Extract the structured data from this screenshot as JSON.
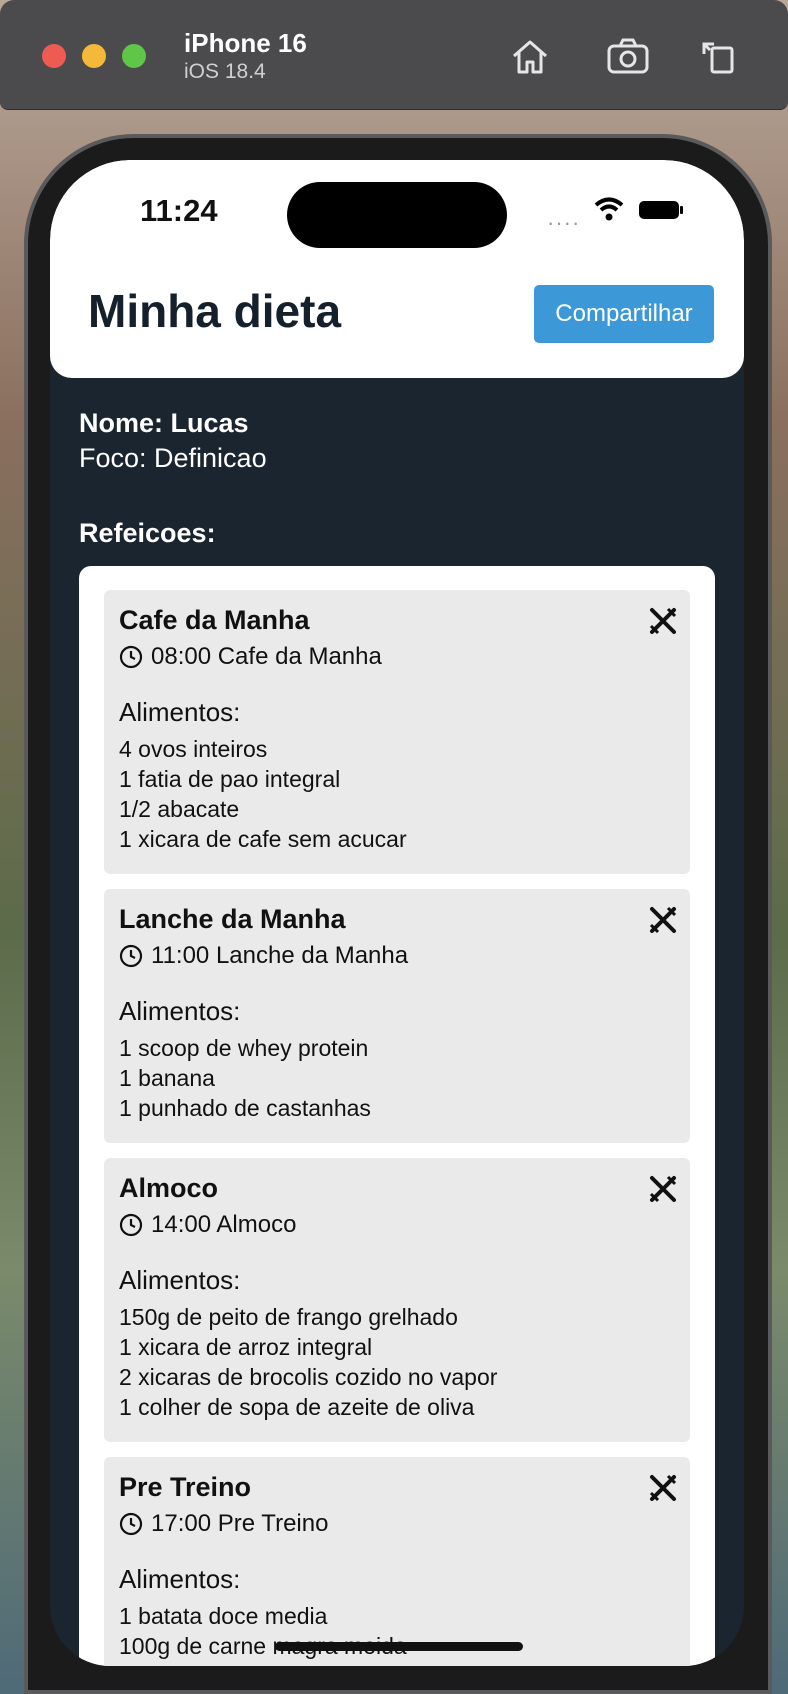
{
  "simulator": {
    "device": "iPhone 16",
    "os": "iOS 18.4"
  },
  "status_bar": {
    "time": "11:24"
  },
  "header": {
    "title": "Minha dieta",
    "share_label": "Compartilhar"
  },
  "profile": {
    "name_line": "Nome: Lucas",
    "focus_line": "Foco: Definicao"
  },
  "meals_label": "Refeicoes:",
  "meals": [
    {
      "title": "Cafe da Manha",
      "time": "08:00 Cafe da Manha",
      "foods_label": "Alimentos:",
      "foods": [
        "4 ovos inteiros",
        "1 fatia de pao integral",
        "1/2 abacate",
        "1 xicara de cafe sem acucar"
      ]
    },
    {
      "title": "Lanche da Manha",
      "time": "11:00 Lanche da Manha",
      "foods_label": "Alimentos:",
      "foods": [
        "1 scoop de whey protein",
        "1 banana",
        "1 punhado de castanhas"
      ]
    },
    {
      "title": "Almoco",
      "time": "14:00 Almoco",
      "foods_label": "Alimentos:",
      "foods": [
        "150g de peito de frango grelhado",
        "1 xicara de arroz integral",
        "2 xicaras de brocolis cozido no vapor",
        "1 colher de sopa de azeite de oliva"
      ]
    },
    {
      "title": "Pre Treino",
      "time": "17:00 Pre Treino",
      "foods_label": "Alimentos:",
      "foods": [
        "1 batata doce media",
        "100g de carne magra moida"
      ]
    }
  ]
}
